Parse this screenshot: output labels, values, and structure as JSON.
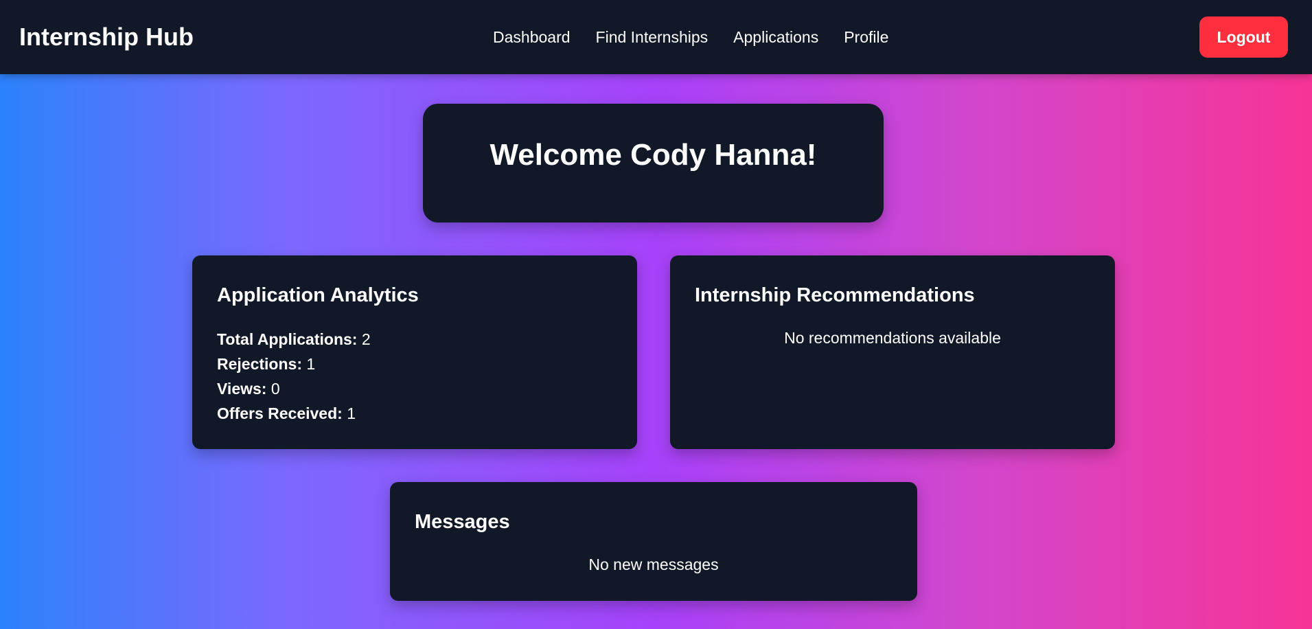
{
  "navbar": {
    "brand": "Internship Hub",
    "links": [
      "Dashboard",
      "Find Internships",
      "Applications",
      "Profile"
    ],
    "logout_label": "Logout"
  },
  "welcome": {
    "title": "Welcome Cody Hanna!"
  },
  "analytics": {
    "title": "Application Analytics",
    "stats": [
      {
        "label": "Total Applications:",
        "value": "2"
      },
      {
        "label": "Rejections:",
        "value": "1"
      },
      {
        "label": "Views:",
        "value": "0"
      },
      {
        "label": "Offers Received:",
        "value": "1"
      }
    ]
  },
  "recommendations": {
    "title": "Internship Recommendations",
    "empty_text": "No recommendations available"
  },
  "messages": {
    "title": "Messages",
    "empty_text": "No new messages"
  },
  "colors": {
    "navbar_bg": "#111827",
    "card_bg": "#111827",
    "logout_bg": "#ff2f3f",
    "gradient_start": "#2c82fb",
    "gradient_mid": "#a742fa",
    "gradient_end": "#f73496"
  }
}
